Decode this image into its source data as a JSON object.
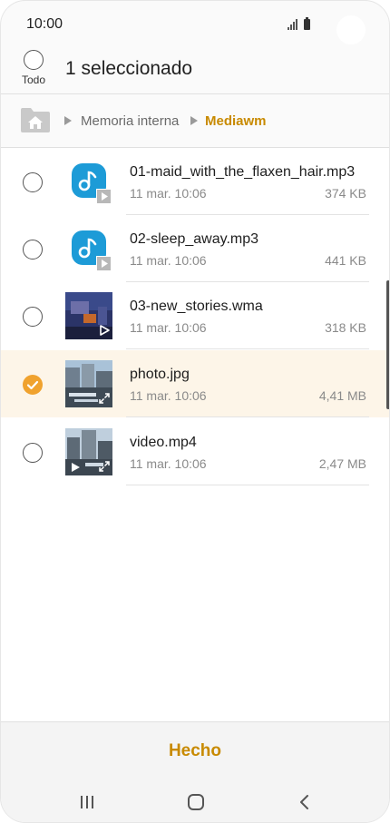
{
  "status_bar": {
    "time": "10:00"
  },
  "header": {
    "select_all_label": "Todo",
    "title": "1 seleccionado"
  },
  "breadcrumb": {
    "items": [
      "Memoria interna",
      "Mediawm"
    ]
  },
  "files": [
    {
      "name": "01-maid_with_the_flaxen_hair.mp3",
      "date": "11 mar. 10:06",
      "size": "374 KB",
      "selected": false,
      "kind": "audio"
    },
    {
      "name": "02-sleep_away.mp3",
      "date": "11 mar. 10:06",
      "size": "441 KB",
      "selected": false,
      "kind": "audio"
    },
    {
      "name": "03-new_stories.wma",
      "date": "11 mar. 10:06",
      "size": "318 KB",
      "selected": false,
      "kind": "media"
    },
    {
      "name": "photo.jpg",
      "date": "11 mar. 10:06",
      "size": "4,41 MB",
      "selected": true,
      "kind": "image"
    },
    {
      "name": "video.mp4",
      "date": "11 mar. 10:06",
      "size": "2,47 MB",
      "selected": false,
      "kind": "video"
    }
  ],
  "bottom": {
    "done_label": "Hecho"
  },
  "colors": {
    "accent": "#c88a00",
    "check": "#f0a22e",
    "music": "#1d9bd7",
    "selected_row": "#fdf5e8"
  },
  "icons": [
    "signal-icon",
    "battery-icon",
    "home-folder-icon",
    "music-note-icon",
    "play-icon",
    "expand-icon",
    "check-icon",
    "recents-icon",
    "home-icon",
    "back-icon"
  ]
}
